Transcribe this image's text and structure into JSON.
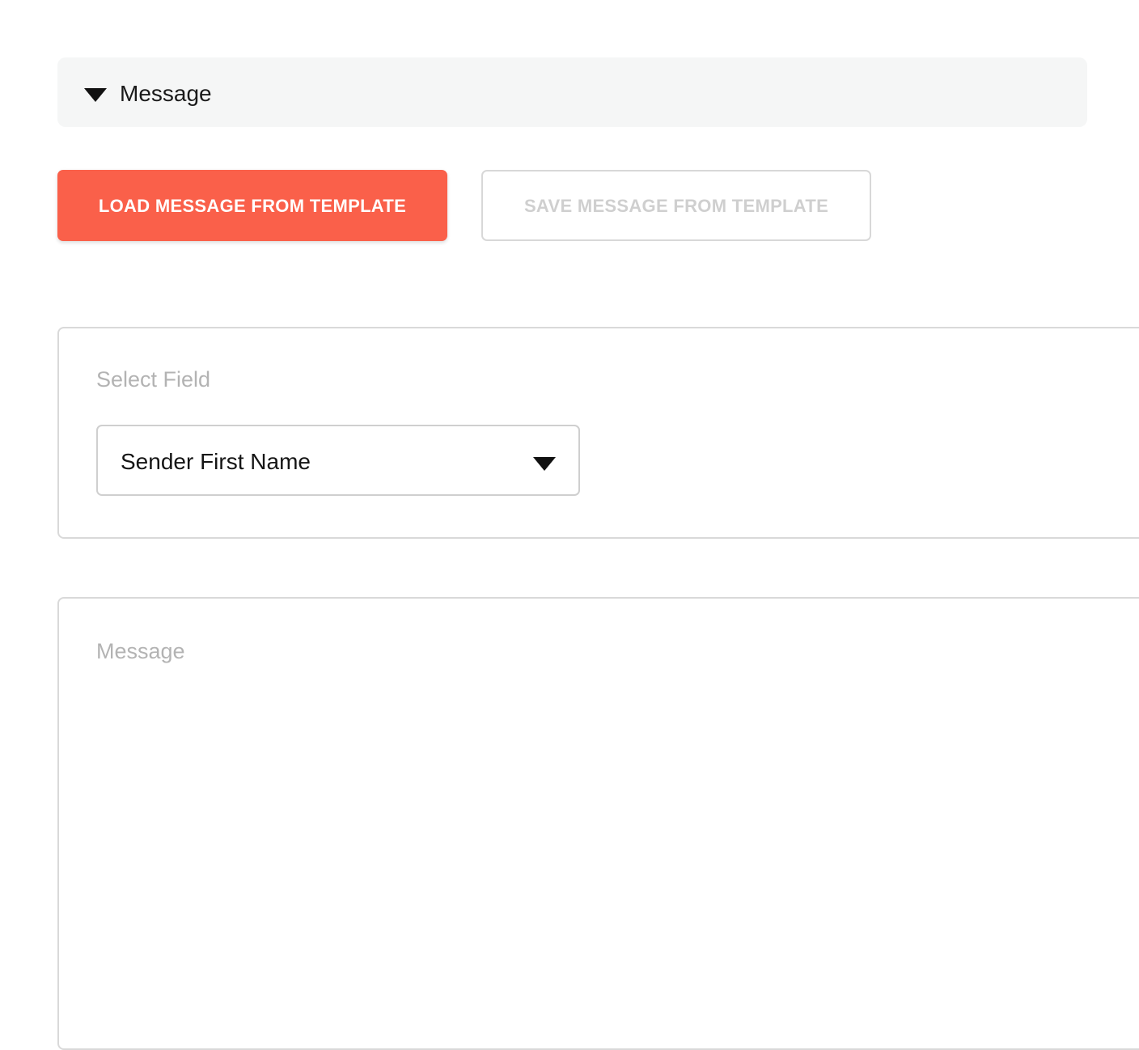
{
  "section": {
    "title": "Message",
    "expanded": true
  },
  "actions": {
    "load_label": "LOAD MESSAGE FROM TEMPLATE",
    "save_label": "SAVE MESSAGE FROM TEMPLATE",
    "save_disabled": true
  },
  "field_select": {
    "label": "Select Field",
    "value": "Sender First Name"
  },
  "message": {
    "label": "Message",
    "value": ""
  },
  "colors": {
    "primary": "#fa604a",
    "header_bg": "#f5f6f6",
    "disabled_text": "#cfcfcf",
    "label_text": "#b3b3b3"
  },
  "icons": {
    "section_toggle": "caret-down-icon",
    "select_toggle": "caret-down-icon"
  }
}
